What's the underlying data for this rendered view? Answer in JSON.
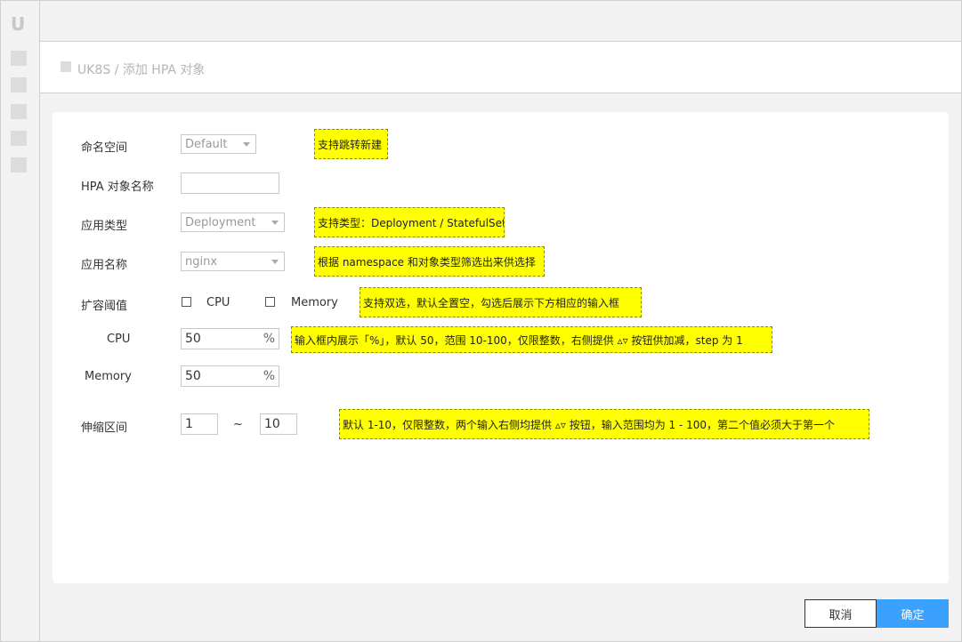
{
  "sidebar": {
    "logo": "U"
  },
  "breadcrumb": {
    "root": "UK8S",
    "separator": "/",
    "current": "添加 HPA 对象"
  },
  "form": {
    "namespace": {
      "label": "命名空间",
      "value": "Default",
      "note": "支持跳转新建"
    },
    "hpa_name": {
      "label": "HPA 对象名称",
      "value": ""
    },
    "app_type": {
      "label": "应用类型",
      "value": "Deployment",
      "note": "支持类型：Deployment / StatefulSet"
    },
    "app_name": {
      "label": "应用名称",
      "value": "nginx",
      "note": "根据 namespace 和对象类型筛选出来供选择"
    },
    "threshold": {
      "label": "扩容阈值",
      "options": [
        {
          "label": "CPU",
          "checked": false
        },
        {
          "label": "Memory",
          "checked": false
        }
      ],
      "note": "支持双选，默认全置空，勾选后展示下方相应的输入框"
    },
    "cpu": {
      "label": "CPU",
      "value": "50",
      "unit": "%",
      "note": "输入框内展示「%」，默认 50，范围 10-100，仅限整数，右侧提供 ▵▿ 按钮供加减，step 为 1"
    },
    "memory": {
      "label": "Memory",
      "value": "50",
      "unit": "%"
    },
    "scale_range": {
      "label": "伸缩区间",
      "min": "1",
      "separator": "~",
      "max": "10",
      "note": "默认 1-10，仅限整数，两个输入右侧均提供 ▵▿ 按钮，输入范围均为 1 - 100，第二个值必须大于第一个"
    }
  },
  "footer": {
    "cancel_label": "取消",
    "confirm_label": "确定"
  },
  "colors": {
    "note_bg": "#ffff00",
    "primary": "#3ba1ff"
  }
}
